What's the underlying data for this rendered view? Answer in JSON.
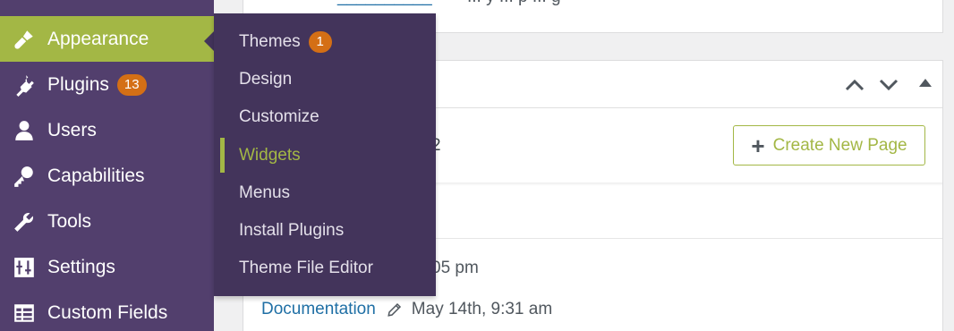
{
  "sidebar": {
    "items": [
      {
        "label": "Appearance",
        "icon": "paint-brush-icon",
        "active": true
      },
      {
        "label": "Plugins",
        "icon": "plug-icon",
        "count": "13"
      },
      {
        "label": "Users",
        "icon": "user-icon"
      },
      {
        "label": "Capabilities",
        "icon": "key-icon"
      },
      {
        "label": "Tools",
        "icon": "wrench-icon"
      },
      {
        "label": "Settings",
        "icon": "sliders-icon"
      },
      {
        "label": "Custom Fields",
        "icon": "table-icon"
      }
    ]
  },
  "flyout": {
    "items": [
      {
        "label": "Themes",
        "count": "1"
      },
      {
        "label": "Design"
      },
      {
        "label": "Customize"
      },
      {
        "label": "Widgets",
        "current": true
      },
      {
        "label": "Menus"
      },
      {
        "label": "Install Plugins"
      },
      {
        "label": "Theme File Editor"
      }
    ]
  },
  "main": {
    "top_link_fragment": "__________",
    "top_text_fragment": "... y ... p ... g",
    "stat_fragment": "2",
    "create_button_label": "Create New Page",
    "time_fragment": "05 pm",
    "recent": {
      "link": "Documentation",
      "date": "May 14th, 9:31 am"
    }
  },
  "colors": {
    "sidebar_bg": "#523f6d",
    "flyout_bg": "#43345b",
    "accent": "#a3b745",
    "badge": "#d46f15",
    "link": "#1f6fa5"
  }
}
